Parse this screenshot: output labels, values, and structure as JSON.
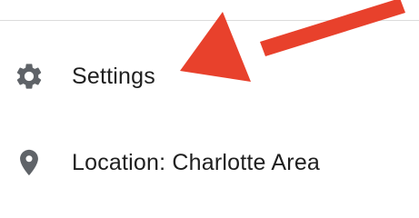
{
  "menu": {
    "items": [
      {
        "label": "Settings",
        "icon": "gear-icon"
      },
      {
        "label": "Location: Charlotte Area",
        "icon": "location-pin-icon"
      }
    ]
  },
  "annotation": {
    "arrow_color": "#e8412c",
    "icon_color": "#5f6368"
  }
}
